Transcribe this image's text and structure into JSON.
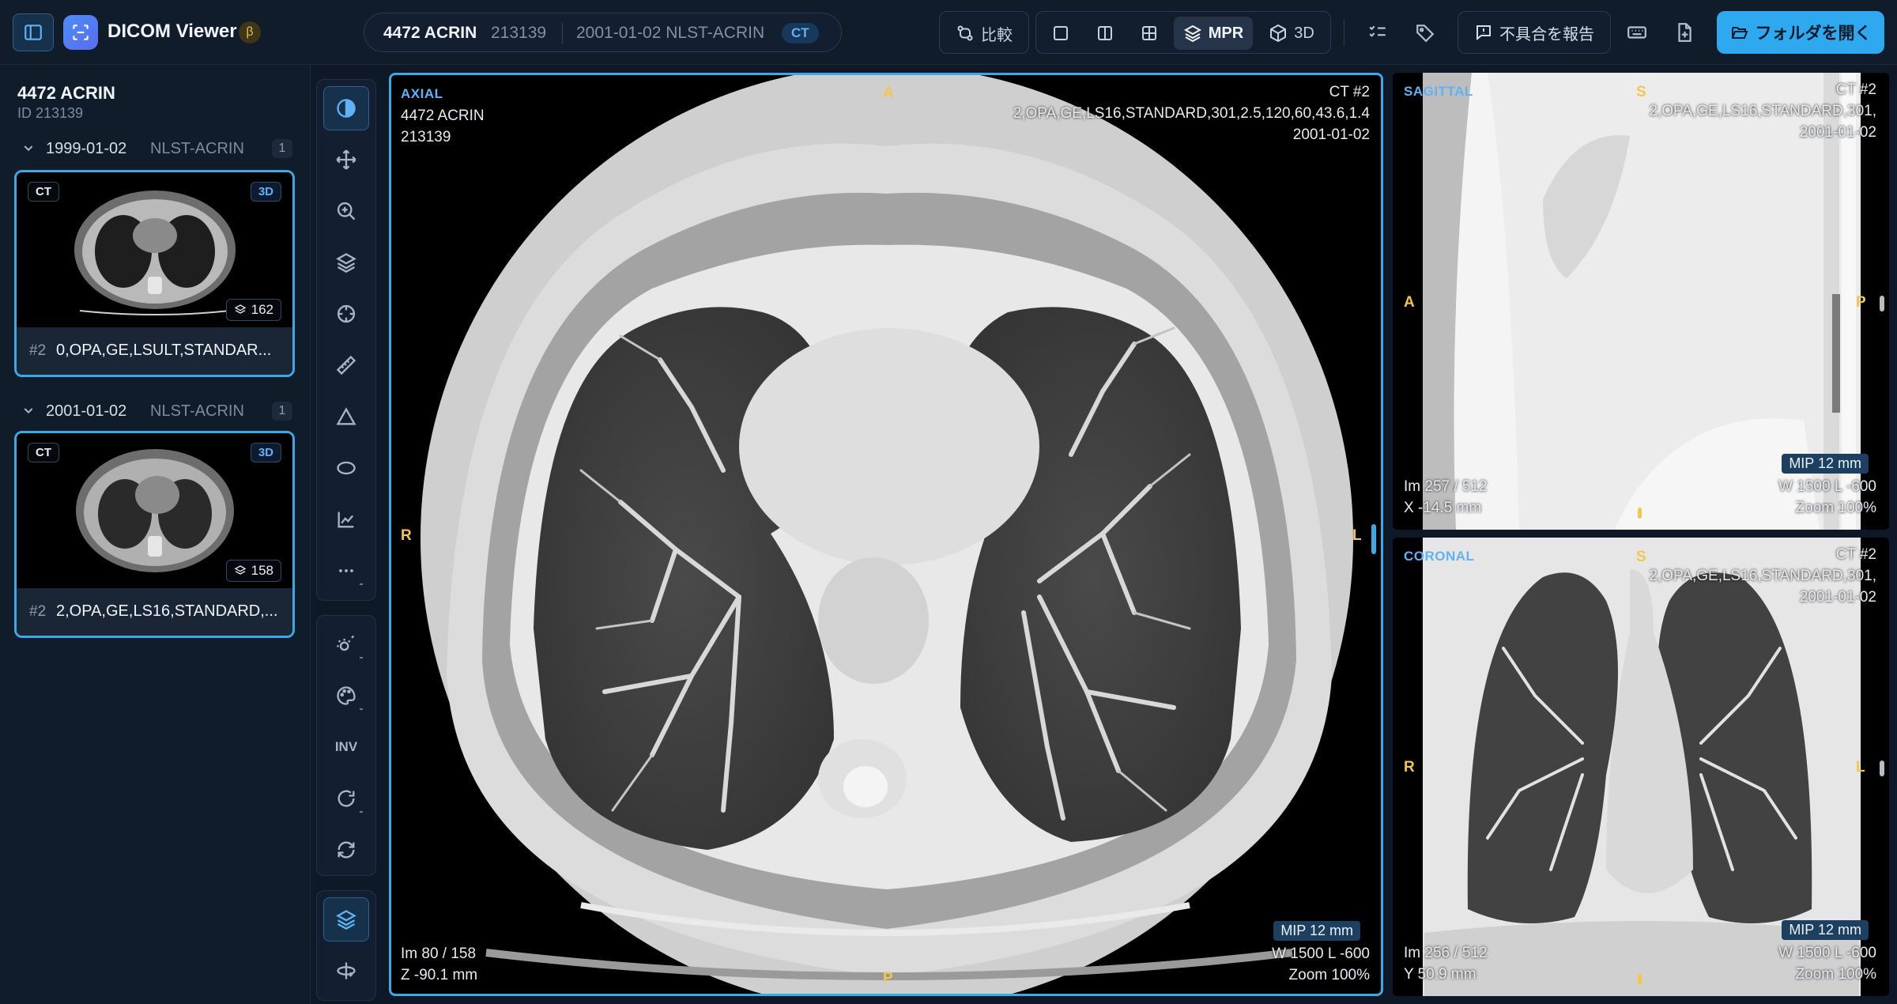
{
  "header": {
    "app_title": "DICOM Viewer",
    "beta": "β",
    "study": {
      "patient": "4472 ACRIN",
      "id": "213139",
      "date_inst": "2001-01-02 NLST-ACRIN",
      "modality": "CT"
    },
    "compare_label": "比較",
    "mpr_label": "MPR",
    "three_d_label": "3D",
    "report_label": "不具合を報告",
    "open_folder_label": "フォルダを開く"
  },
  "sidebar": {
    "patient_name": "4472 ACRIN",
    "patient_id": "ID 213139",
    "studies": [
      {
        "date": "1999-01-02",
        "institution": "NLST-ACRIN",
        "count": "1",
        "series": {
          "modality": "CT",
          "badge": "3D",
          "images": "162",
          "number": "#2",
          "description": "0,OPA,GE,LSULT,STANDAR..."
        }
      },
      {
        "date": "2001-01-02",
        "institution": "NLST-ACRIN",
        "count": "1",
        "series": {
          "modality": "CT",
          "badge": "3D",
          "images": "158",
          "number": "#2",
          "description": "2,OPA,GE,LS16,STANDARD,..."
        }
      }
    ]
  },
  "toolrail": {
    "invert_label": "INV"
  },
  "viewports": {
    "axial": {
      "label": "AXIAL",
      "patient": "4472 ACRIN",
      "patient_id": "213139",
      "series": "CT #2",
      "series_desc": "2,OPA,GE,LS16,STANDARD,301,2.5,120,60,43.6,1.4",
      "date": "2001-01-02",
      "orient_top": "A",
      "orient_bottom": "P",
      "orient_left": "R",
      "orient_right": "L",
      "mip": "MIP 12 mm",
      "window": "W 1500 L -600",
      "zoom": "Zoom 100%",
      "image": "Im 80 / 158",
      "position": "Z -90.1 mm"
    },
    "sagittal": {
      "label": "SAGITTAL",
      "series": "CT #2",
      "series_desc": "2,OPA,GE,LS16,STANDARD,301,",
      "date": "2001-01-02",
      "orient_top": "S",
      "orient_left": "A",
      "orient_right": "P",
      "mip": "MIP 12 mm",
      "window": "W 1500 L -600",
      "zoom": "Zoom 100%",
      "image": "Im 257 / 512",
      "position": "X -14.5 mm"
    },
    "coronal": {
      "label": "CORONAL",
      "series": "CT #2",
      "series_desc": "2,OPA,GE,LS16,STANDARD,301,",
      "date": "2001-01-02",
      "orient_top": "S",
      "orient_left": "R",
      "orient_right": "L",
      "mip": "MIP 12 mm",
      "window": "W 1500 L -600",
      "zoom": "Zoom 100%",
      "image": "Im 256 / 512",
      "position": "Y 50.9 mm"
    }
  },
  "colors": {
    "accent": "#3ba8e8",
    "orientation": "#f4c650",
    "primary_button": "#2ea8ee"
  }
}
